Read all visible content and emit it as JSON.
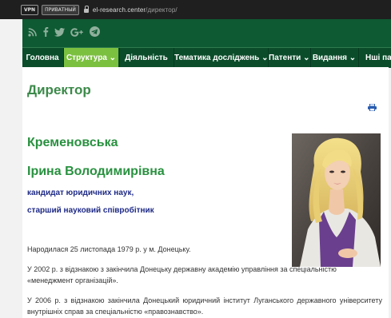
{
  "browser": {
    "vpn_label": "VPN",
    "private_label": "ПРИВАТНЫЙ",
    "url_domain": "el-research.center",
    "url_path": "/директор/"
  },
  "header": {
    "social_icons": [
      "rss-icon",
      "facebook-icon",
      "twitter-icon",
      "google-plus-icon",
      "telegram-icon"
    ],
    "background": "#0e5a33"
  },
  "nav": {
    "items": [
      {
        "label": "Головна"
      },
      {
        "label": "Структура ⌄"
      },
      {
        "label": "Діяльність"
      },
      {
        "label": "Тематика досліджень ⌄"
      },
      {
        "label": "Патенти ⌄"
      },
      {
        "label": "Видання ⌄"
      },
      {
        "label": "Нші па"
      }
    ],
    "active_index": 1,
    "active_color": "#7cc040"
  },
  "page": {
    "title": "Директор",
    "surname": "Кременовська",
    "given_names": "Ірина Володимирівна",
    "degree": "кандидат юридичних наук,",
    "rank": "старший науковий співробітник",
    "paragraphs": [
      "Народилася 25 листопада 1979 р. у м. Донецьку.",
      "У 2002 р. з відзнакою з закінчила Донецьку державну академію управління за спеціальністю «менеджмент організацій».",
      "У 2006 р. з відзнакою закінчила Донецький юридичний інститут Луганського державного університету внутрішніх справ за спеціальністю «правознавство»."
    ],
    "accent_green": "#28913f",
    "accent_blue": "#1e2a86"
  }
}
